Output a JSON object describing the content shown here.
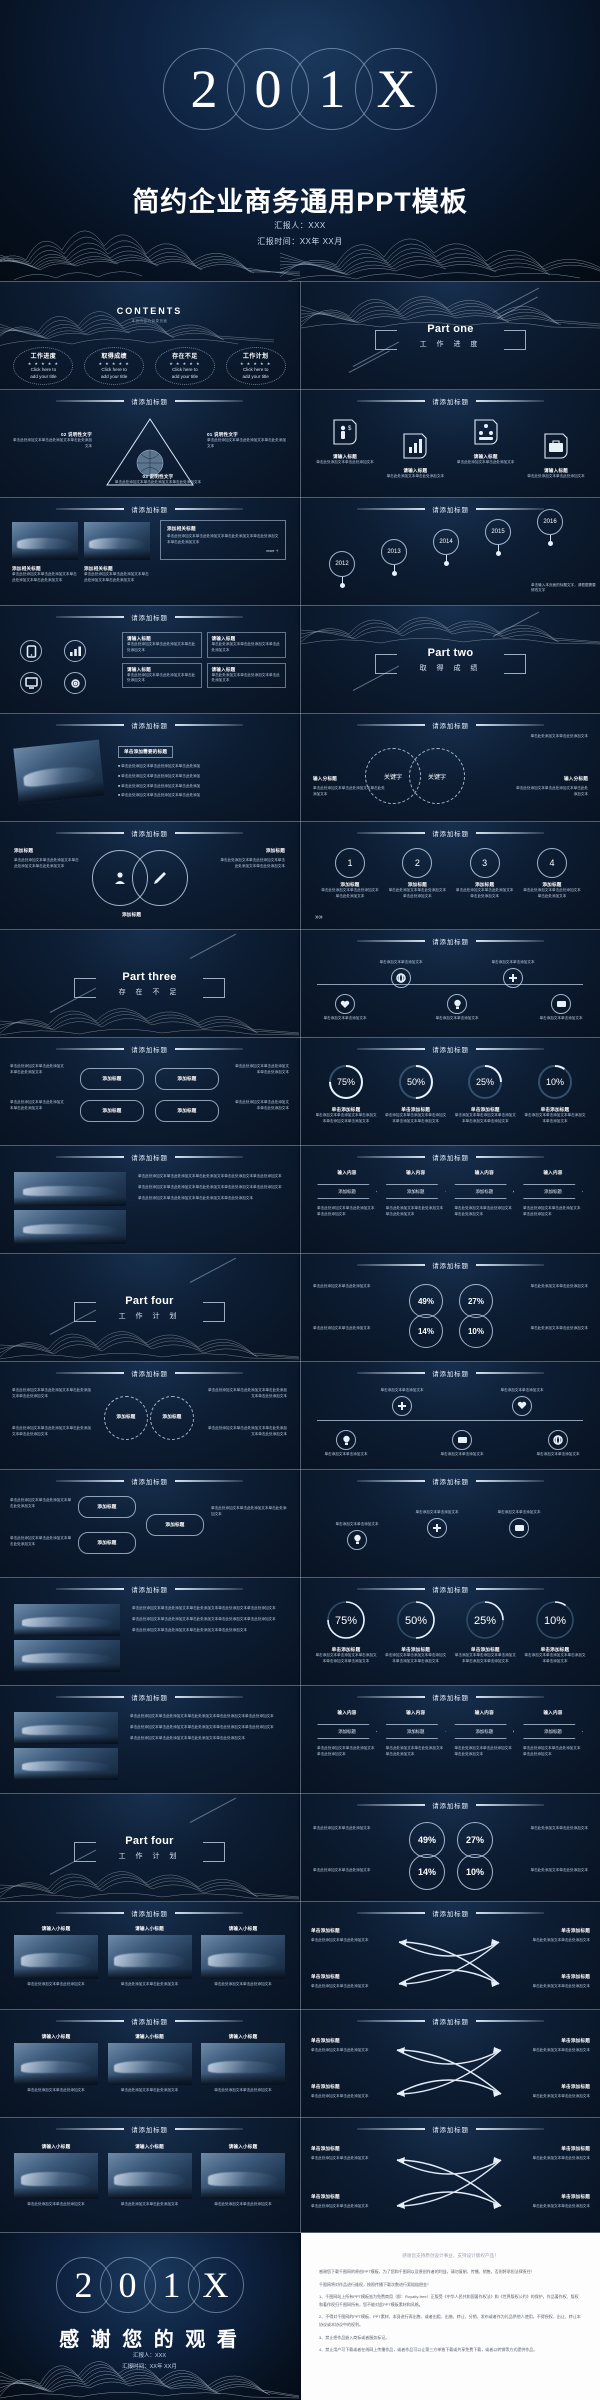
{
  "meta": {
    "accent": "#0d1d33",
    "ink": "#dfe8f3",
    "common_header": "请添加标题",
    "body_filler": "单击添加文本单击添加文本单击添加文本单击添加文本",
    "body_filler_short": "单击添加文本单击添加文本",
    "add_title": "单击添加标题",
    "add_text": "单击添加文本"
  },
  "title_slide": {
    "year_digits": [
      "2",
      "0",
      "1",
      "X"
    ],
    "title": "简约企业商务通用PPT模板",
    "presenter": "汇报人：XXX",
    "date": "汇报时间：XX年 XX月"
  },
  "contents": {
    "label": "CONTENTS",
    "sublabel": "本页内容为目录页面",
    "stars": "★ ★ ★ ★ ★",
    "items": [
      {
        "title": "工作进度",
        "line1": "Click here to",
        "line2": "add your title"
      },
      {
        "title": "取得成绩",
        "line1": "Click here to",
        "line2": "add your title"
      },
      {
        "title": "存在不足",
        "line1": "Click here to",
        "line2": "add your title"
      },
      {
        "title": "工作计划",
        "line1": "Click here to",
        "line2": "add your title"
      }
    ]
  },
  "parts": [
    {
      "en": "Part one",
      "cn": "工 作 进 度"
    },
    {
      "en": "Part two",
      "cn": "取 得 成 绩"
    },
    {
      "en": "Part three",
      "cn": "存 在 不 足"
    },
    {
      "en": "Part four",
      "cn": "工 作 计 划"
    }
  ],
  "slide_triangle": {
    "header": "请添加标题",
    "items": [
      {
        "num": "01",
        "label": "说明性文字",
        "body": "单击此处添加文本单击此处添加文本单击此处添加文本"
      },
      {
        "num": "02",
        "label": "说明性文字",
        "body": "单击此处添加文本单击此处添加文本单击此处添加文本"
      },
      {
        "num": "03",
        "label": "说明性文字",
        "body": "单击此处添加文本单击此处添加文本单击此处添加文本"
      }
    ]
  },
  "slide_shields": {
    "header": "请添加标题",
    "cards": [
      {
        "title": "请输入标题",
        "icon": "person-money-icon",
        "body": "单击此处添加文本单击此处添加文本"
      },
      {
        "title": "请输入标题",
        "icon": "chart-up-icon",
        "body": "单击此处添加文本单击此处添加文本"
      },
      {
        "title": "请输入标题",
        "icon": "team-icon",
        "body": "单击此处添加文本单击此处添加文本"
      },
      {
        "title": "请输入标题",
        "icon": "briefcase-icon",
        "body": "单击此处添加文本单击此处添加文本"
      }
    ]
  },
  "slide_photo_cards": {
    "header": "请添加标题",
    "panel_title": "添加相关标题",
    "panel_body": "单击此处添加文本单击此处添加文本单击此处添加文本单击此处添加文本单击此处添加文本",
    "panel_more": "more ＋",
    "cards": [
      {
        "title": "添加相关标题",
        "body": "单击此处添加文本单击此处添加文本单击此处添加文本单击此处添加文本"
      },
      {
        "title": "添加相关标题",
        "body": "单击此处添加文本单击此处添加文本单击此处添加文本单击此处添加文本"
      }
    ]
  },
  "slide_timeline": {
    "header": "请添加标题",
    "years": [
      "2012",
      "2013",
      "2014",
      "2015",
      "2016"
    ],
    "note": "单击输入本页面的标题文字，请根据需要修改文字"
  },
  "slide_icon_grid": {
    "header": "请添加标题",
    "icons": [
      "phone-icon",
      "chart-bar-icon",
      "gear-icon",
      "monitor-icon"
    ],
    "boxes": [
      {
        "title": "请输入标题",
        "body": "单击此处添加文本单击此处添加文本单击此处添加文本"
      },
      {
        "title": "请输入标题",
        "body": "单击此处添加文本单击此处添加文本单击此处添加文本"
      },
      {
        "title": "请输入标题",
        "body": "单击此处添加文本单击此处添加文本单击此处添加文本"
      },
      {
        "title": "请输入标题",
        "body": "单击此处添加文本单击此处添加文本单击此处添加文本"
      }
    ]
  },
  "slide_bullets": {
    "header": "请添加标题",
    "panel_title": "单击添加需要的标题",
    "bullets": [
      "单击此处添加文本单击此处添加文本单击此处添加",
      "单击此处添加文本单击此处添加文本单击此处添加",
      "单击此处添加文本单击此处添加文本单击此处添加",
      "单击此处添加文本单击此处添加文本单击此处添加"
    ]
  },
  "slide_venn": {
    "header": "请添加标题",
    "left_key": "关键字",
    "right_key": "关键字",
    "top_note": "单击此处添加文本单击此处添加文本",
    "input_label_1": "输入分标题",
    "input_label_2": "输入分标题",
    "body": "单击此处添加文本单击此处添加文本单击此处添加文本"
  },
  "slide_overlap": {
    "header": "请添加标题",
    "labels": [
      "添加标题",
      "添加标题",
      "添加标题"
    ],
    "body": "单击此处添加文本单击此处添加文本单击此处添加文本单击此处添加文本"
  },
  "slide_steps": {
    "header": "请添加标题",
    "steps": [
      {
        "num": "1",
        "title": "添加标题",
        "body": "单击此处添加文本单击此处添加文本单击此处添加文本"
      },
      {
        "num": "2",
        "title": "添加标题",
        "body": "单击此处添加文本单击此处添加文本单击此处添加文本"
      },
      {
        "num": "3",
        "title": "添加标题",
        "body": "单击此处添加文本单击此处添加文本单击此处添加文本"
      },
      {
        "num": "4",
        "title": "添加标题",
        "body": "单击此处添加文本单击此处添加文本单击此处添加文本"
      }
    ]
  },
  "slide_zigzag": {
    "header": "请添加标题",
    "nodes": [
      {
        "icon": "heart-icon",
        "label": "单击添加文本单击添加文本"
      },
      {
        "icon": "globe-icon",
        "label": "单击添加文本单击添加文本"
      },
      {
        "icon": "bulb-icon",
        "label": "单击添加文本单击添加文本"
      },
      {
        "icon": "plus-icon",
        "label": "单击添加文本单击添加文本"
      },
      {
        "icon": "card-icon",
        "label": "单击添加文本单击添加文本"
      }
    ]
  },
  "slide_flow": {
    "header": "请添加标题",
    "bubbles": [
      "添加标题",
      "添加标题",
      "添加标题",
      "添加标题"
    ],
    "body": "单击此处添加文本单击此处添加文本单击此处添加文本"
  },
  "slide_donuts": {
    "header": "请添加标题",
    "items": [
      {
        "percent": "75%",
        "title": "单击添加标题",
        "body": "单击添加文本单击添加文本单击添加文本单击添加文本单击添加文本"
      },
      {
        "percent": "50%",
        "title": "单击添加标题",
        "body": "单击添加文本单击添加文本单击添加文本单击添加文本单击添加文本"
      },
      {
        "percent": "25%",
        "title": "单击添加标题",
        "body": "单击添加文本单击添加文本单击添加文本单击添加文本单击添加文本"
      },
      {
        "percent": "10%",
        "title": "单击添加标题",
        "body": "单击添加文本单击添加文本单击添加文本单击添加文本"
      }
    ]
  },
  "slide_two_photo": {
    "header": "请添加标题",
    "paragraphs": [
      "单击此处添加文本单击此处添加文本单击此处添加文本单击此处添加文本单击此处添加文本",
      "单击此处添加文本单击此处添加文本单击此处添加文本单击此处添加文本单击此处添加文本",
      "单击此处添加文本单击此处添加文本单击此处添加文本单击此处添加文本"
    ]
  },
  "slide_chevrons": {
    "header": "请添加标题",
    "tops": [
      "输入内容",
      "输入内容",
      "输入内容",
      "输入内容"
    ],
    "chevrons": [
      "添加标题",
      "添加标题",
      "添加标题",
      "添加标题"
    ],
    "body": "单击此处添加文本单击此处添加文本单击此处添加文本"
  },
  "slide_gauges": {
    "header": "请添加标题",
    "values": [
      "49%",
      "27%",
      "14%",
      "10%"
    ],
    "caption": "单击此处添加文本单击此处添加文本"
  },
  "slide_three_photos": {
    "header": "请添加标题",
    "cards": [
      {
        "caption": "请输入小标题",
        "body": "单击此处添加文本单击此处添加文本"
      },
      {
        "caption": "请输入小标题",
        "body": "单击此处添加文本单击此处添加文本"
      },
      {
        "caption": "请输入小标题",
        "body": "单击此处添加文本单击此处添加文本"
      }
    ]
  },
  "slide_arrows": {
    "header": "请添加标题",
    "labels": [
      "单击添加标题",
      "单击添加标题",
      "单击添加标题",
      "单击添加标题"
    ],
    "body": "单击此处添加文本单击此处添加文本"
  },
  "thanks_slide": {
    "year_digits": [
      "2",
      "0",
      "1",
      "X"
    ],
    "title": "感 谢 您 的 观 看",
    "presenter": "汇报人：XXX",
    "date": "汇报时间：XX年 XX月"
  },
  "legal_slide": {
    "heading": "感谢您支持原创设计事业，支持设计版权产品！",
    "paragraphs": [
      "感谢您下载千图网的原创PPT模板，为了您和千图网以及原创作者的利益，请勿复制、传播、销售，否则将承担法律责任！",
      "千图网将对作品进行维权，按照传播下载次数进行索赔赔偿金！",
      "1、千图网站上所有PPT模板皆为免费商用（即：Royalty-free）正版受《中华人民共和国著作权法》和《世界版权公约》的保护，作品著作权、版权和著作权归千图网所有，您不能对此PPT模板素材和风格。",
      "2、不得对千图网的PPT模板、PPT素材、本身进行再出售、或者出租、出借、转让、分销、发布或者作为礼品供他人使用，不得授权、出让、转让本协议或本协议中的权利。",
      "3、禁止把作品嵌入商标或者服务标记。",
      "4、禁止用户可下载或者在线网上传播作品，或者作品可以让第三方单独下载或共享免费下载，或者以转销等方式提供作品。"
    ]
  }
}
